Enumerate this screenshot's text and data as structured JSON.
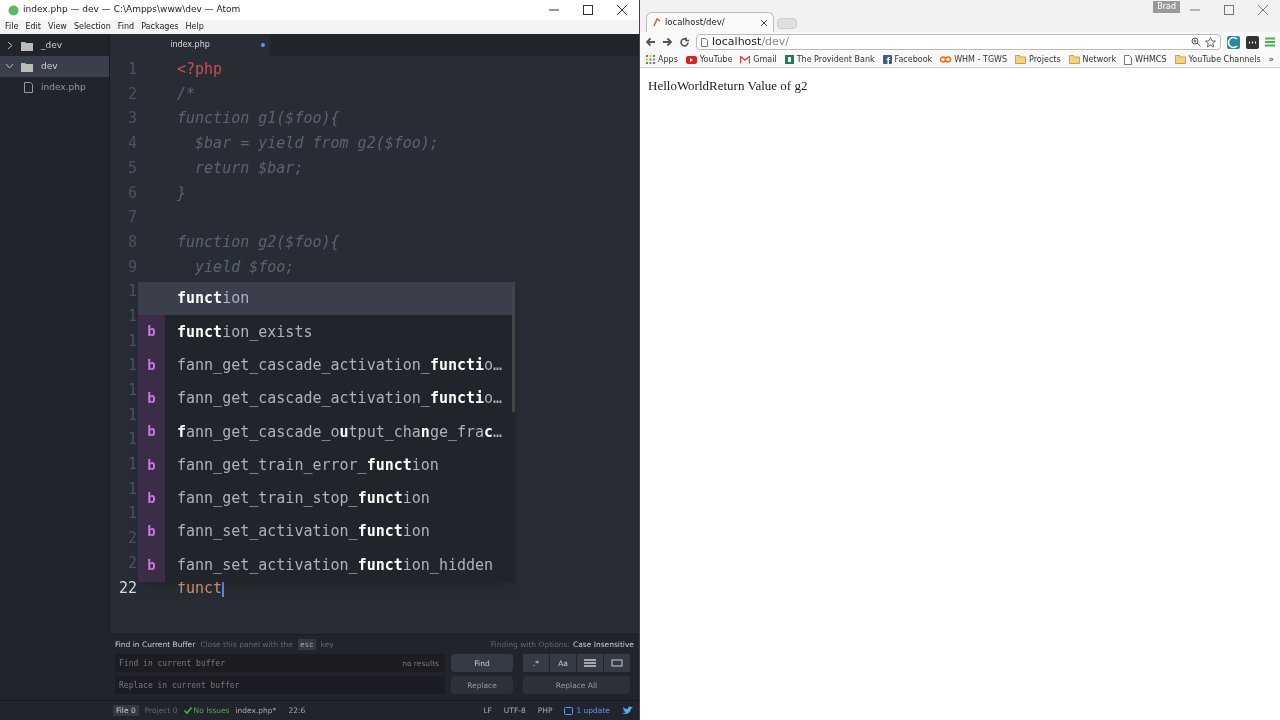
{
  "atom": {
    "title": "index.php — dev — C:\\Ampps\\www\\dev — Atom",
    "menu": [
      "File",
      "Edit",
      "View",
      "Selection",
      "Find",
      "Packages",
      "Help"
    ],
    "tree": [
      {
        "label": "_dev",
        "kind": "folder",
        "expanded": false,
        "selected": false
      },
      {
        "label": "dev",
        "kind": "folder",
        "expanded": true,
        "selected": true,
        "children": [
          {
            "label": "index.php",
            "kind": "file",
            "selected": false
          }
        ]
      }
    ],
    "tabs": [
      {
        "label": "index.php",
        "selected": true,
        "modified": true
      }
    ],
    "lines": [
      {
        "number": "1",
        "code": "<?php",
        "kind": "tag"
      },
      {
        "number": "2",
        "code": "/*",
        "kind": "comment"
      },
      {
        "number": "3",
        "code": "function g1($foo){",
        "kind": "comment"
      },
      {
        "number": "4",
        "code": "  $bar = yield from g2($foo);",
        "kind": "comment"
      },
      {
        "number": "5",
        "code": "  return $bar;",
        "kind": "comment"
      },
      {
        "number": "6",
        "code": "}",
        "kind": "comment"
      },
      {
        "number": "7",
        "kind": "comment"
      },
      {
        "number": "8",
        "code": "function g2($foo){",
        "kind": "comment"
      },
      {
        "number": "9",
        "code": "  yield $foo;",
        "kind": "comment"
      },
      {
        "number": "1",
        "kind": "hidden"
      },
      {
        "number": "1",
        "kind": "hidden"
      },
      {
        "number": "1",
        "kind": "hidden"
      },
      {
        "number": "1",
        "kind": "hidden"
      },
      {
        "number": "1",
        "kind": "hidden"
      },
      {
        "number": "1",
        "kind": "hidden"
      },
      {
        "number": "1",
        "kind": "hidden"
      },
      {
        "number": "1",
        "kind": "hidden"
      },
      {
        "number": "1",
        "kind": "hidden"
      },
      {
        "number": "1",
        "kind": "hidden"
      },
      {
        "number": "2",
        "kind": "hidden"
      },
      {
        "number": "2",
        "kind": "hidden"
      },
      {
        "number": "22",
        "code": "funct",
        "kind": "current"
      }
    ],
    "autocomplete": [
      {
        "text": "**funct**ion",
        "selected": true
      },
      {
        "type": "b",
        "text": "**funct**ion_exists",
        "selected": false
      },
      {
        "type": "b",
        "text": "fann_get_cascade_activation_**functi**o…",
        "selected": false
      },
      {
        "type": "b",
        "text": "fann_get_cascade_activation_**functi**o…",
        "selected": false
      },
      {
        "type": "b",
        "text": "**f**ann_get_cascade_o**u**tput_cha**n**ge_fra**c**…",
        "selected": false
      },
      {
        "type": "b",
        "text": "fann_get_train_error_**funct**ion",
        "selected": false
      },
      {
        "type": "b",
        "text": "fann_get_train_stop_**funct**ion",
        "selected": false
      },
      {
        "type": "b",
        "text": "fann_set_activation_**funct**ion",
        "selected": false
      },
      {
        "type": "b",
        "text": "fann_set_activation_**funct**ion_hidden",
        "selected": false
      }
    ],
    "find_panel": {
      "title": "Find in Current Buffer",
      "hint": "Close this panel with the",
      "key": "esc",
      "hint_end": "key",
      "options_label": "Finding with Options:",
      "options_value": "Case Insensitive",
      "find_placeholder": "Find in current buffer",
      "results": "no results",
      "replace_placeholder": "Replace in current buffer",
      "find_button": "Find",
      "regex_button": ".*",
      "case_button": "Aa",
      "replace_button": "Replace",
      "replace_all_button": "Replace All"
    },
    "status_bar": {
      "file": "File 0",
      "project": "Project 0",
      "issues": "No Issues",
      "filename": "index.php*",
      "cursor": "22:6",
      "line_ending": "LF",
      "encoding": "UTF-8",
      "grammar": "PHP",
      "updates": "1 update"
    }
  },
  "browser": {
    "tab": "localhost/dev/",
    "user": "Brad",
    "url_host": "localhost",
    "url_path": "/dev/",
    "bookmarks": [
      {
        "label": "Apps",
        "kind": "apps"
      },
      {
        "label": "YouTube",
        "kind": "video"
      },
      {
        "label": "Gmail",
        "kind": "mail"
      },
      {
        "label": "The Provident Bank",
        "kind": "bank"
      },
      {
        "label": "Facebook",
        "kind": "social"
      },
      {
        "label": "WHM - TGWS",
        "kind": "hosting"
      },
      {
        "label": "Projects",
        "kind": "folder"
      },
      {
        "label": "Network",
        "kind": "folder"
      },
      {
        "label": "WHMCS",
        "kind": "page"
      },
      {
        "label": "YouTube Channels",
        "kind": "folder"
      }
    ],
    "more": "»",
    "content": "HelloWorldReturn Value of g2"
  }
}
